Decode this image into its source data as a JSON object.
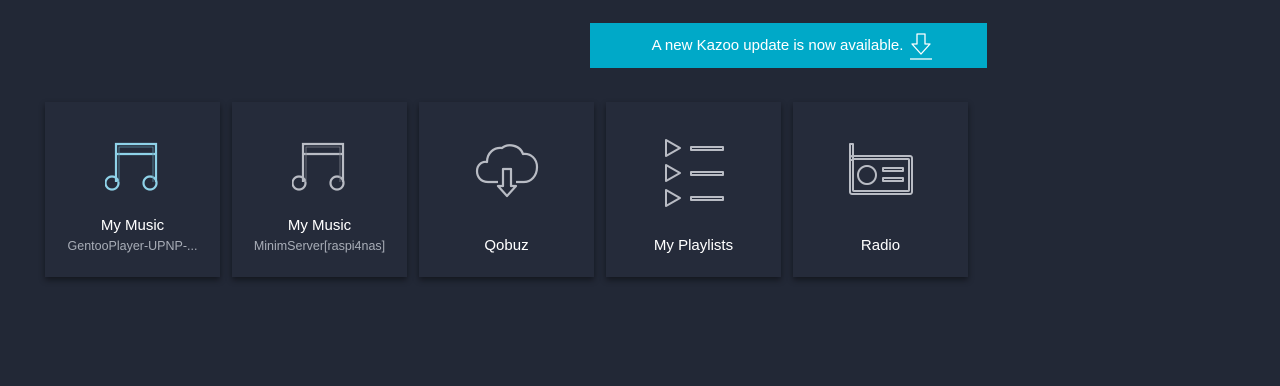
{
  "update_banner": {
    "text": "A new Kazoo update is now available.",
    "icon": "download-icon"
  },
  "tiles": [
    {
      "title": "My Music",
      "subtitle": "GentooPlayer-UPNP-...",
      "icon": "music-note-icon",
      "icon_color": "#8fd2e8"
    },
    {
      "title": "My Music",
      "subtitle": "MinimServer[raspi4nas]",
      "icon": "music-note-icon",
      "icon_color": "#b9bcc4"
    },
    {
      "title": "Qobuz",
      "subtitle": "",
      "icon": "cloud-download-icon",
      "icon_color": "#b9bcc4"
    },
    {
      "title": "My Playlists",
      "subtitle": "",
      "icon": "playlist-icon",
      "icon_color": "#b9bcc4"
    },
    {
      "title": "Radio",
      "subtitle": "",
      "icon": "radio-icon",
      "icon_color": "#b9bcc4"
    }
  ],
  "colors": {
    "background": "#222836",
    "tile": "#252b3a",
    "banner": "#00a9c8"
  }
}
